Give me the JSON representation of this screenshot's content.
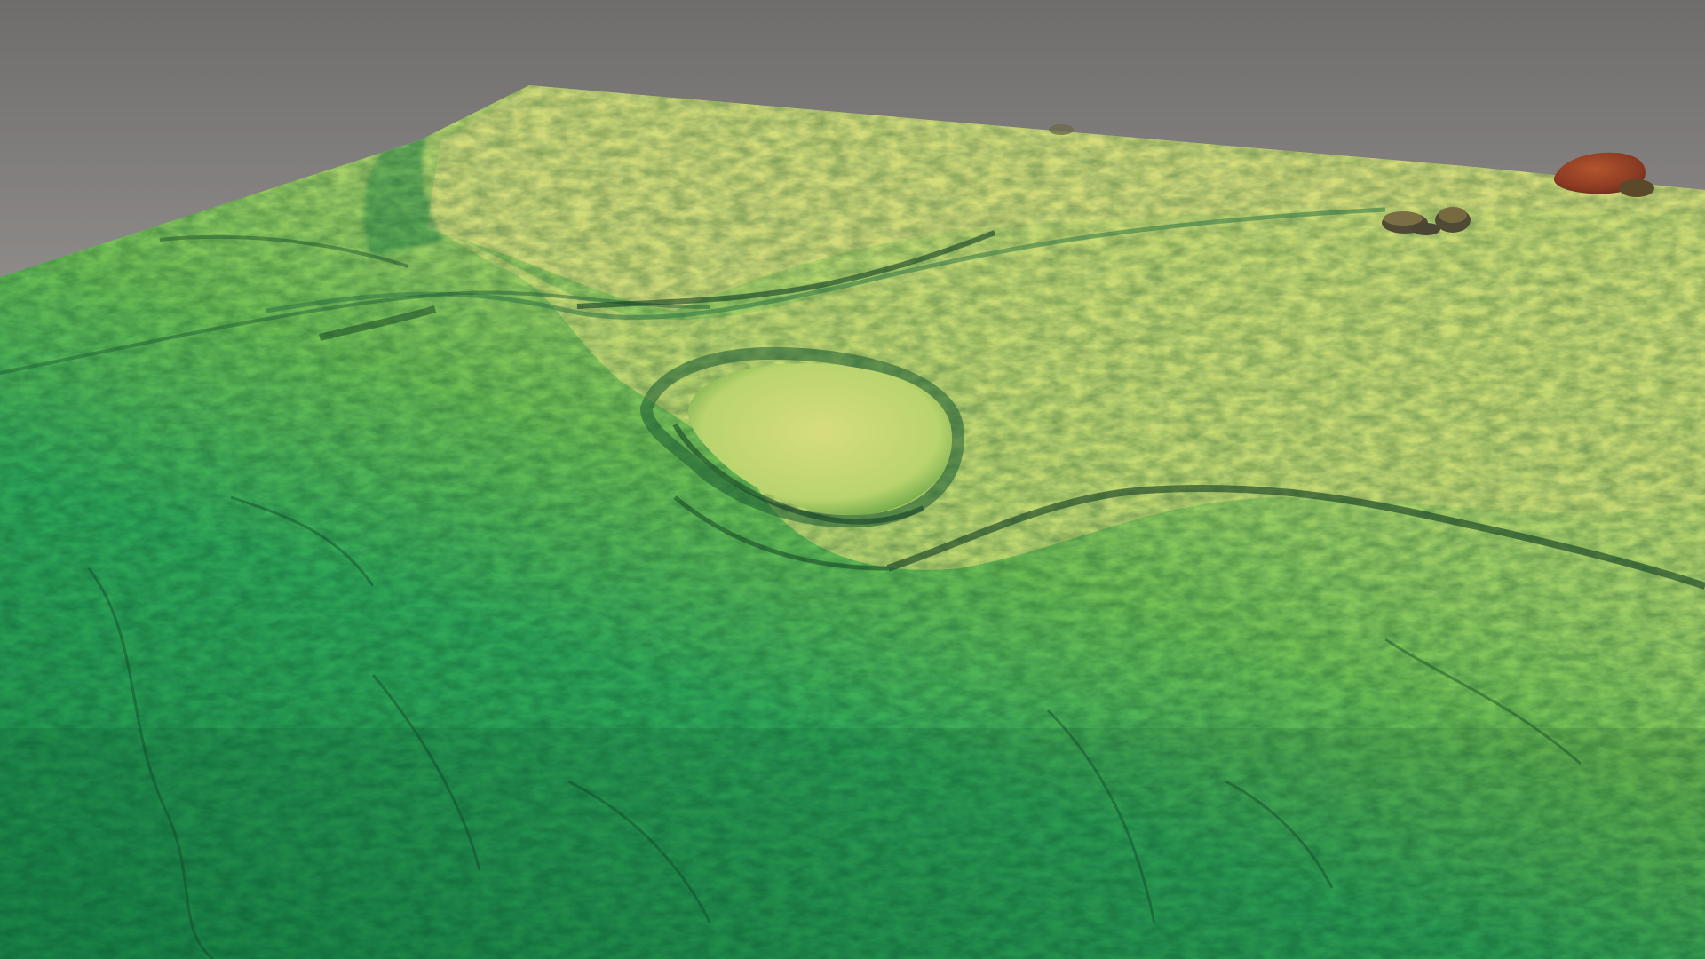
{
  "scene": {
    "subject": "terrain-relief-model",
    "colors": {
      "background_top": "#6e6c6b",
      "background_bottom": "#a3a09e",
      "terrain_low": "#1f9a55",
      "terrain_mid": "#6cc04e",
      "terrain_high": "#c9dd7a",
      "terrain_peak": "#a0472b",
      "ridge_shadow": "#0f3b22"
    }
  }
}
